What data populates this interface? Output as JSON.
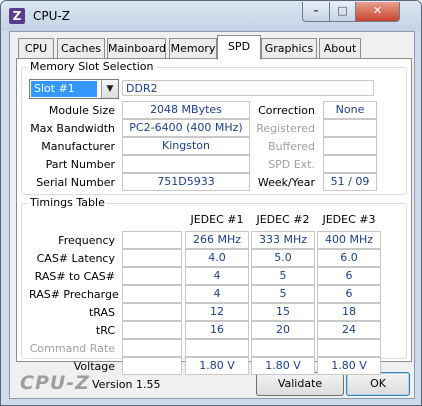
{
  "window": {
    "title": "CPU-Z",
    "icon": "cpu-z-app-icon"
  },
  "titlebar_buttons": {
    "minimize": "–",
    "maximize": "□",
    "close": "✕"
  },
  "tabs": [
    "CPU",
    "Caches",
    "Mainboard",
    "Memory",
    "SPD",
    "Graphics",
    "About"
  ],
  "active_tab": "SPD",
  "slot_section": {
    "legend": "Memory Slot Selection",
    "slot_selected": "Slot #1",
    "memory_type": "DDR2",
    "labels": {
      "module_size": "Module Size",
      "max_bandwidth": "Max Bandwidth",
      "manufacturer": "Manufacturer",
      "part_number": "Part Number",
      "serial_number": "Serial Number",
      "correction": "Correction",
      "registered": "Registered",
      "buffered": "Buffered",
      "spd_ext": "SPD Ext.",
      "week_year": "Week/Year"
    },
    "values": {
      "module_size": "2048 MBytes",
      "max_bandwidth": "PC2-6400 (400 MHz)",
      "manufacturer": "Kingston",
      "part_number": "",
      "serial_number": "751D5933",
      "correction": "None",
      "registered": "",
      "buffered": "",
      "spd_ext": "",
      "week_year": "51 / 09"
    }
  },
  "timings": {
    "legend": "Timings Table",
    "columns": [
      "JEDEC #1",
      "JEDEC #2",
      "JEDEC #3"
    ],
    "rows": [
      {
        "label": "Frequency",
        "values": [
          "266 MHz",
          "333 MHz",
          "400 MHz"
        ]
      },
      {
        "label": "CAS# Latency",
        "values": [
          "4.0",
          "5.0",
          "6.0"
        ]
      },
      {
        "label": "RAS# to CAS#",
        "values": [
          "4",
          "5",
          "6"
        ]
      },
      {
        "label": "RAS# Precharge",
        "values": [
          "4",
          "5",
          "6"
        ]
      },
      {
        "label": "tRAS",
        "values": [
          "12",
          "15",
          "18"
        ]
      },
      {
        "label": "tRC",
        "values": [
          "16",
          "20",
          "24"
        ]
      },
      {
        "label": "Command Rate",
        "values": [
          "",
          "",
          ""
        ]
      },
      {
        "label": "Voltage",
        "values": [
          "1.80 V",
          "1.80 V",
          "1.80 V"
        ]
      }
    ]
  },
  "footer": {
    "logo": "CPU-Z",
    "version": "Version 1.55",
    "validate_label": "Validate",
    "ok_label": "OK"
  },
  "colors": {
    "value_text": "#1b3f8f",
    "selection": "#3399ff",
    "close_button": "#c7442d",
    "logo_gray": "#9e9e9e"
  }
}
